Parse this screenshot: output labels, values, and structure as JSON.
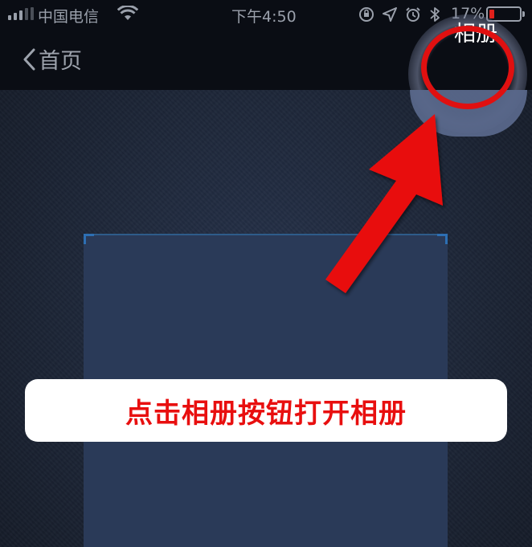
{
  "status_bar": {
    "carrier": "中国电信",
    "time": "下午4:50",
    "battery_percent": "17%",
    "battery_level": 0.17,
    "icons": [
      "signal-icon",
      "wifi-icon",
      "orientation-lock-icon",
      "location-icon",
      "alarm-icon",
      "bluetooth-icon",
      "battery-icon"
    ]
  },
  "nav_bar": {
    "back_label": "首页",
    "album_label": "相册"
  },
  "annotation": {
    "callout_text": "点击相册按钮打开相册",
    "highlight_color": "#e01010",
    "arrow_color": "#e8100f"
  }
}
